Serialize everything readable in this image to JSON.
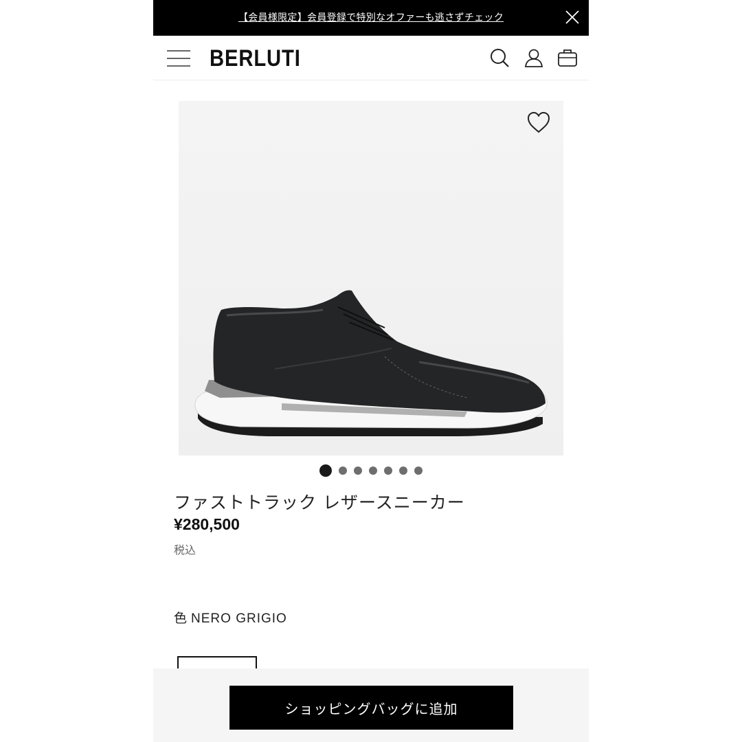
{
  "promo": {
    "text": "【会員様限定】会員登録で特別なオファーも逃さずチェック",
    "close_icon": "close-icon"
  },
  "header": {
    "logo": "BERLUTI",
    "icons": [
      "menu-icon",
      "search-icon",
      "account-icon",
      "shopping-bag-icon"
    ]
  },
  "product": {
    "image_alt_icon": "sneaker",
    "wishlist_icon": "heart-icon",
    "gallery": {
      "count": 7,
      "active_index": 0
    },
    "name": "ファストトラック レザースニーカー",
    "price": "¥280,500",
    "tax_note": "税込",
    "color_label": "色",
    "color_value": "NERO GRIGIO"
  },
  "cta": {
    "add_to_bag": "ショッピングバッグに追加"
  },
  "colors": {
    "promo_bg": "#000000",
    "cta_bg": "#000000",
    "image_bg": "#f1f1f1",
    "bottom_bar_bg": "#f5f5f5"
  }
}
